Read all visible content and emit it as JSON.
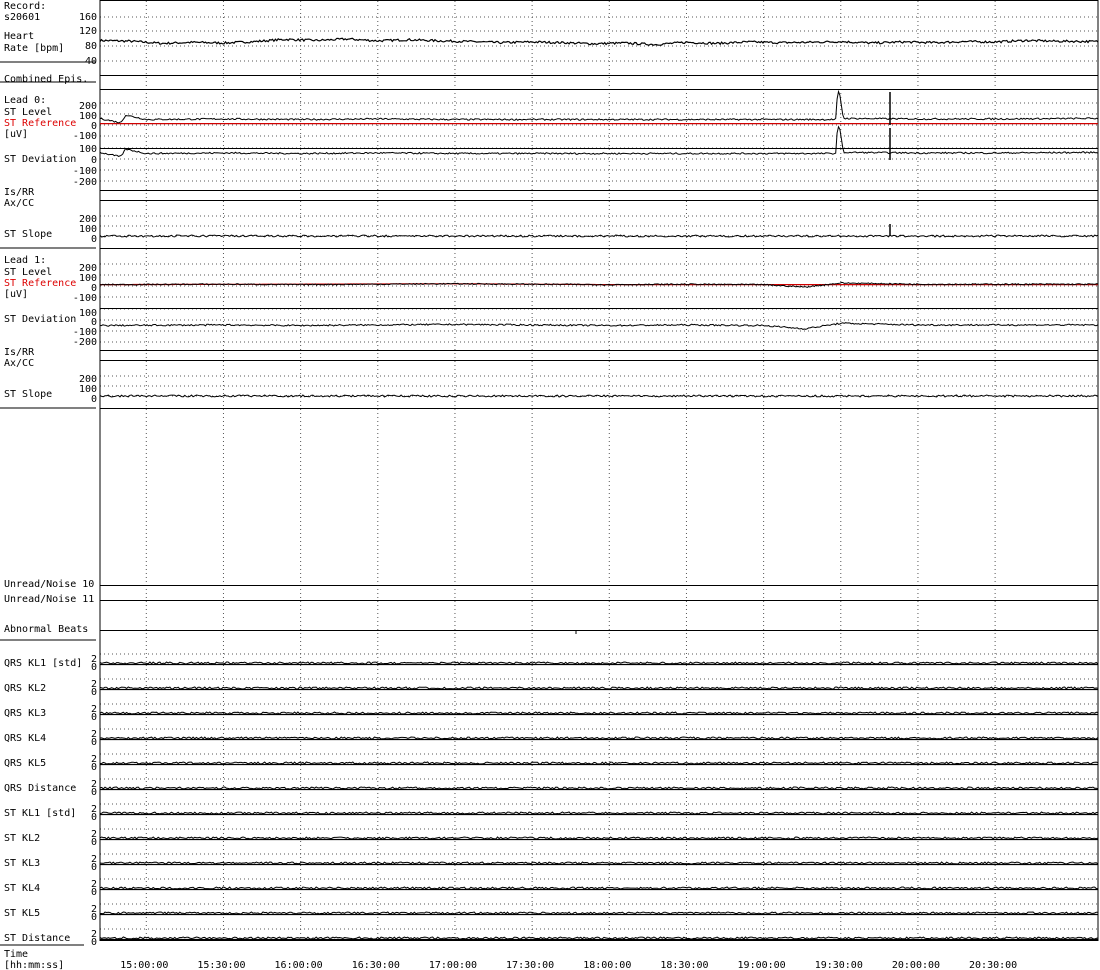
{
  "record": {
    "label": "Record:",
    "id": "s20601"
  },
  "colors": {
    "trace": "#000000",
    "reference": "#d00000",
    "grid": "#555555",
    "background": "#ffffff"
  },
  "panels": [
    {
      "key": "hr",
      "lines": [
        "Heart",
        "Rate [bpm]"
      ],
      "ticks": [
        "160",
        "120",
        "80",
        "40"
      ]
    },
    {
      "key": "epis",
      "lines": [
        "Combined Epis."
      ],
      "ticks": []
    },
    {
      "key": "l0_level",
      "lines": [
        "Lead 0:",
        "ST Level",
        "ST Reference",
        "[uV]"
      ],
      "ticks": [
        "200",
        "100",
        "0",
        "-100"
      ]
    },
    {
      "key": "l0_dev",
      "lines": [
        "ST Deviation"
      ],
      "ticks": [
        "100",
        "0",
        "-100",
        "-200"
      ]
    },
    {
      "key": "l0_isrr",
      "lines": [
        "Is/RR"
      ],
      "ticks": []
    },
    {
      "key": "l0_axcc",
      "lines": [
        "Ax/CC"
      ],
      "ticks": []
    },
    {
      "key": "l0_slope",
      "lines": [
        "ST Slope"
      ],
      "ticks": [
        "200",
        "100",
        "0"
      ]
    },
    {
      "key": "l1_level",
      "lines": [
        "Lead 1:",
        "ST Level",
        "ST Reference",
        "[uV]"
      ],
      "ticks": [
        "200",
        "100",
        "0",
        "-100"
      ]
    },
    {
      "key": "l1_dev",
      "lines": [
        "ST Deviation"
      ],
      "ticks": [
        "100",
        "0",
        "-100",
        "-200"
      ]
    },
    {
      "key": "l1_isrr",
      "lines": [
        "Is/RR"
      ],
      "ticks": []
    },
    {
      "key": "l1_axcc",
      "lines": [
        "Ax/CC"
      ],
      "ticks": []
    },
    {
      "key": "l1_slope",
      "lines": [
        "ST Slope"
      ],
      "ticks": [
        "200",
        "100",
        "0"
      ]
    },
    {
      "key": "noise10",
      "lines": [
        "Unread/Noise 10"
      ],
      "ticks": []
    },
    {
      "key": "noise11",
      "lines": [
        "Unread/Noise 11"
      ],
      "ticks": []
    },
    {
      "key": "abn",
      "lines": [
        "Abnormal Beats"
      ],
      "ticks": []
    },
    {
      "key": "qrs_kl1",
      "lines": [
        "QRS KL1 [std]"
      ],
      "ticks": [
        "2",
        "0"
      ]
    },
    {
      "key": "qrs_kl2",
      "lines": [
        "QRS KL2"
      ],
      "ticks": [
        "2",
        "0"
      ]
    },
    {
      "key": "qrs_kl3",
      "lines": [
        "QRS KL3"
      ],
      "ticks": [
        "2",
        "0"
      ]
    },
    {
      "key": "qrs_kl4",
      "lines": [
        "QRS KL4"
      ],
      "ticks": [
        "2",
        "0"
      ]
    },
    {
      "key": "qrs_kl5",
      "lines": [
        "QRS KL5"
      ],
      "ticks": [
        "2",
        "0"
      ]
    },
    {
      "key": "qrs_dist",
      "lines": [
        "QRS Distance"
      ],
      "ticks": [
        "2",
        "0"
      ]
    },
    {
      "key": "st_kl1",
      "lines": [
        "ST KL1 [std]"
      ],
      "ticks": [
        "2",
        "0"
      ]
    },
    {
      "key": "st_kl2",
      "lines": [
        "ST KL2"
      ],
      "ticks": [
        "2",
        "0"
      ]
    },
    {
      "key": "st_kl3",
      "lines": [
        "ST KL3"
      ],
      "ticks": [
        "2",
        "0"
      ]
    },
    {
      "key": "st_kl4",
      "lines": [
        "ST KL4"
      ],
      "ticks": [
        "2",
        "0"
      ]
    },
    {
      "key": "st_kl5",
      "lines": [
        "ST KL5"
      ],
      "ticks": [
        "2",
        "0"
      ]
    },
    {
      "key": "st_dist",
      "lines": [
        "ST Distance"
      ],
      "ticks": [
        "2",
        "0"
      ]
    }
  ],
  "time_axis": {
    "lines": [
      "Time",
      "[hh:mm:ss]"
    ],
    "ticks": [
      "15:00:00",
      "15:30:00",
      "16:00:00",
      "16:30:00",
      "17:00:00",
      "17:30:00",
      "18:00:00",
      "18:30:00",
      "19:00:00",
      "19:30:00",
      "20:00:00",
      "20:30:00"
    ]
  },
  "chart_data": {
    "type": "line",
    "x_unit": "hh:mm:ss",
    "xlim": [
      "14:42:00",
      "21:10:00"
    ],
    "series": [
      {
        "name": "Heart Rate [bpm]",
        "ylim": [
          40,
          160
        ],
        "x": [
          "14:42:00",
          "14:54:00",
          "15:06:00",
          "15:18:00",
          "15:30:00",
          "15:42:00",
          "15:54:00",
          "16:06:00",
          "16:18:00",
          "16:30:00",
          "16:42:00",
          "16:54:00",
          "17:06:00",
          "17:18:00",
          "17:30:00",
          "17:42:00",
          "17:54:00",
          "18:06:00",
          "18:18:00",
          "18:30:00",
          "18:42:00",
          "18:54:00",
          "19:06:00",
          "19:18:00",
          "19:30:00",
          "19:42:00",
          "19:54:00",
          "20:06:00",
          "20:18:00",
          "20:30:00",
          "20:42:00",
          "20:54:00",
          "21:10:00"
        ],
        "values": [
          96,
          94,
          88,
          91,
          89,
          93,
          99,
          96,
          100,
          95,
          98,
          95,
          93,
          90,
          92,
          90,
          87,
          89,
          85,
          91,
          88,
          92,
          90,
          91,
          93,
          89,
          92,
          90,
          93,
          92,
          96,
          94,
          93
        ]
      },
      {
        "name": "Lead 0 ST Level [uV]",
        "ylim": [
          -150,
          250
        ],
        "x": [
          "14:42:00",
          "14:50:00",
          "14:52:00",
          "15:00:00",
          "15:30:00",
          "16:00:00",
          "16:30:00",
          "17:00:00",
          "17:30:00",
          "18:00:00",
          "18:30:00",
          "19:00:00",
          "19:28:00",
          "19:29:00",
          "19:31:00",
          "20:00:00",
          "20:30:00",
          "21:10:00"
        ],
        "values": [
          10,
          -30,
          40,
          0,
          5,
          0,
          5,
          0,
          0,
          0,
          0,
          0,
          0,
          320,
          10,
          5,
          5,
          10
        ]
      },
      {
        "name": "Lead 0 ST Reference [uV]",
        "ylim": [
          -150,
          250
        ],
        "x": [
          "14:42:00",
          "21:10:00"
        ],
        "values": [
          0,
          0
        ]
      },
      {
        "name": "Lead 1 ST Level [uV]",
        "ylim": [
          -150,
          250
        ],
        "x": [
          "14:42:00",
          "15:30:00",
          "16:00:00",
          "16:30:00",
          "17:00:00",
          "17:30:00",
          "18:00:00",
          "18:30:00",
          "19:00:00",
          "19:16:00",
          "19:30:00",
          "20:00:00",
          "20:30:00",
          "21:10:00"
        ],
        "values": [
          0,
          5,
          0,
          5,
          10,
          5,
          0,
          5,
          0,
          -30,
          20,
          5,
          5,
          5
        ]
      },
      {
        "name": "Lead 1 ST Reference [uV]",
        "ylim": [
          -150,
          250
        ],
        "x": [
          "14:42:00",
          "17:00:00",
          "18:00:00",
          "21:10:00"
        ],
        "values": [
          0,
          10,
          0,
          0
        ]
      }
    ],
    "xlabel": "Time [hh:mm:ss]",
    "grid": true
  }
}
